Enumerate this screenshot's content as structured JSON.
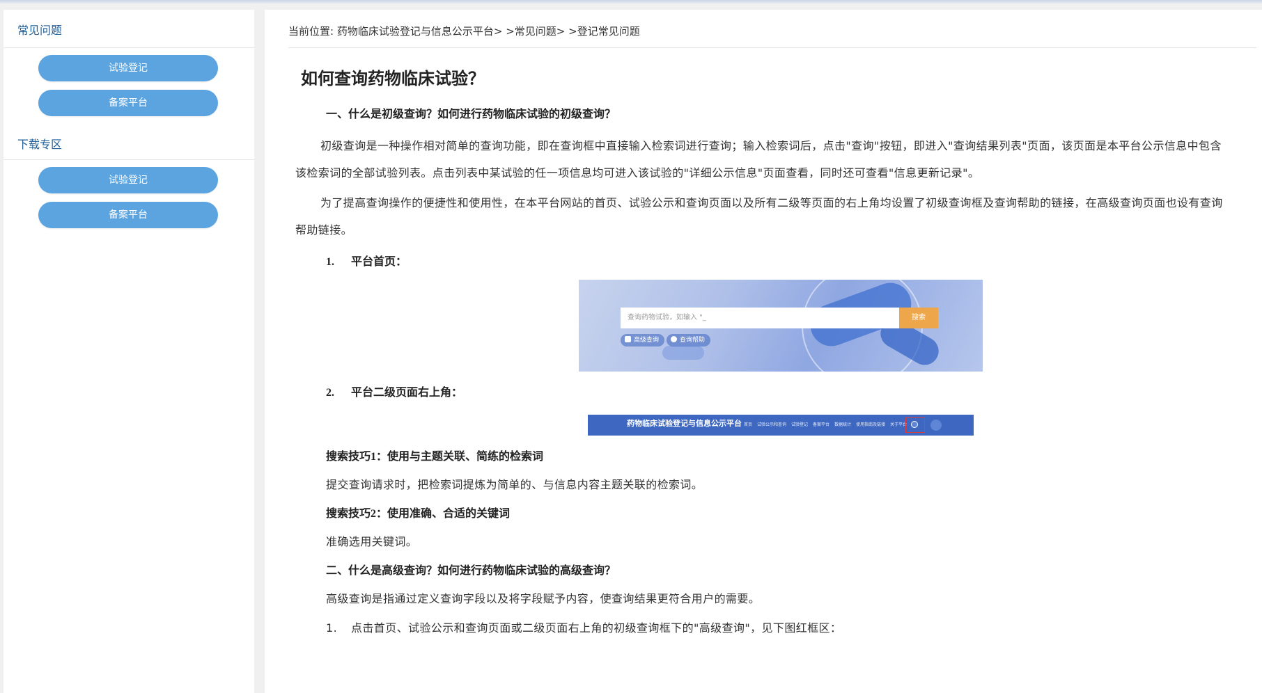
{
  "sidebar": {
    "faq_title": "常见问题",
    "faq_buttons": [
      "试验登记",
      "备案平台"
    ],
    "download_title": "下载专区",
    "download_buttons": [
      "试验登记",
      "备案平台"
    ]
  },
  "breadcrumb": {
    "prefix": "当前位置:",
    "site": "药物临床试验登记与信息公示平台",
    "sep": "> >",
    "section": "常见问题",
    "current": "登记常见问题"
  },
  "article": {
    "title": "如何查询药物临床试验？",
    "sec1_heading": "一、什么是初级查询？如何进行药物临床试验的初级查询？",
    "para1": "初级查询是一种操作相对简单的查询功能，即在查询框中直接输入检索词进行查询；输入检索词后，点击\"查询\"按钮，即进入\"查询结果列表\"页面，该页面是本平台公示信息中包含该检索词的全部试验列表。点击列表中某试验的任一项信息均可进入该试验的\"详细公示信息\"页面查看，同时还可查看\"信息更新记录\"。",
    "para2": "为了提高查询操作的便捷性和使用性，在本平台网站的首页、试验公示和查询页面以及所有二级等页面的右上角均设置了初级查询框及查询帮助的链接，在高级查询页面也设有查询帮助链接。",
    "step1_num": "1.",
    "step1_text": "平台首页：",
    "fig1": {
      "search_placeholder": "查询药物试验，如输入 \"_",
      "search_button": "搜索",
      "advanced": "高级查询",
      "help": "查询帮助"
    },
    "step2_num": "2.",
    "step2_text": "平台二级页面右上角：",
    "fig2": {
      "title": "药物临床试验登记与信息公示平台",
      "nav": [
        "首页",
        "试验公示和查询",
        "试验登记",
        "备案平台",
        "数据统计",
        "使用指南及链接",
        "关于平台"
      ]
    },
    "tip1_heading": "搜索技巧1：使用与主题关联、简练的检索词",
    "tip1_text": "提交查询请求时，把检索词提炼为简单的、与信息内容主题关联的检索词。",
    "tip2_heading": "搜索技巧2：使用准确、合适的关键词",
    "tip2_text": "准确选用关键词。",
    "sec2_heading": "二、什么是高级查询？如何进行药物临床试验的高级查询？",
    "sec2_text": "高级查询是指通过定义查询字段以及将字段赋予内容，使查询结果更符合用户的需要。",
    "step3_num": "1.",
    "step3_text": "点击首页、试验公示和查询页面或二级页面右上角的初级查询框下的\"高级查询\"，见下图红框区："
  }
}
